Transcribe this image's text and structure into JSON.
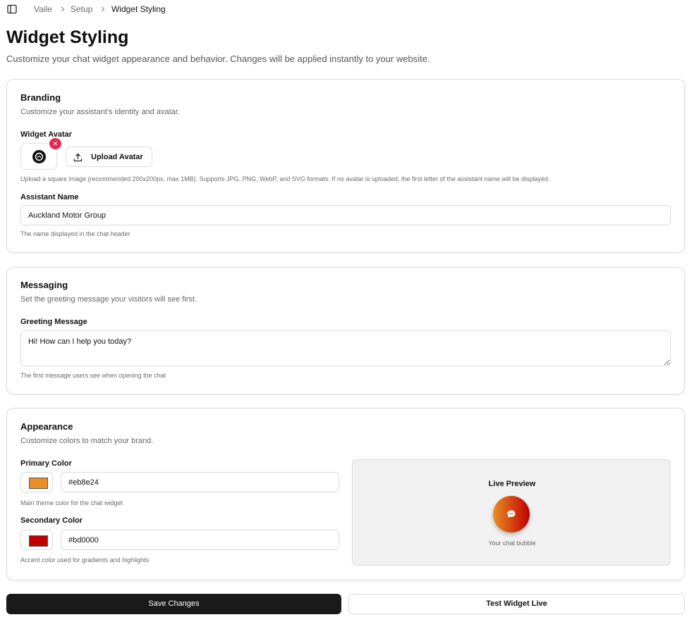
{
  "breadcrumb": {
    "items": [
      "Vaile",
      "Setup",
      "Widget Styling"
    ]
  },
  "header": {
    "title": "Widget Styling",
    "subtitle": "Customize your chat widget appearance and behavior. Changes will be applied instantly to your website."
  },
  "branding": {
    "title": "Branding",
    "description": "Customize your assistant's identity and avatar.",
    "avatar_label": "Widget Avatar",
    "upload_label": "Upload Avatar",
    "upload_hint": "Upload a square image (recommended 200x200px, max 1MB). Supports JPG, PNG, WebP, and SVG formats. If no avatar is uploaded, the first letter of the assistant name will be displayed.",
    "name_label": "Assistant Name",
    "name_value": "Auckland Motor Group",
    "name_hint": "The name displayed in the chat header"
  },
  "messaging": {
    "title": "Messaging",
    "description": "Set the greeting message your visitors will see first.",
    "greeting_label": "Greeting Message",
    "greeting_value": "Hi! How can I help you today?",
    "greeting_hint": "The first message users see when opening the chat"
  },
  "appearance": {
    "title": "Appearance",
    "description": "Customize colors to match your brand.",
    "primary_label": "Primary Color",
    "primary_value": "#eb8e24",
    "primary_hint": "Main theme color for the chat widget",
    "secondary_label": "Secondary Color",
    "secondary_value": "#bd0000",
    "secondary_hint": "Accent color used for gradients and highlights",
    "preview_title": "Live Preview",
    "preview_caption": "Your chat bubble"
  },
  "actions": {
    "save_label": "Save Changes",
    "test_label": "Test Widget Live"
  },
  "colors": {
    "primary": "#eb8e24",
    "secondary": "#bd0000",
    "remove_badge": "#e3294f"
  },
  "icons": {
    "sidebar_toggle": "sidebar-panel-icon",
    "chevron": "chevron-right-icon",
    "remove": "close-icon",
    "upload": "upload-icon",
    "bubble": "chat-bubble-icon"
  }
}
